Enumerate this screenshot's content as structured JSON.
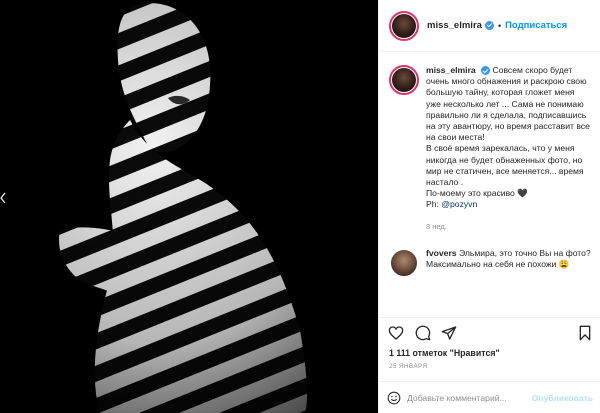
{
  "post": {
    "username": "miss_elmira",
    "follow_label": "Подписаться",
    "separator": "•",
    "caption": {
      "username": "miss_elmira",
      "text": "Совсем скоро будет очень много обнажения и раскрою свою большую тайну, которая гложет меня уже несколько лет ... Сама не понимаю правильно ли я сделала, подписавшись на эту авантюру, но время расставит все на свои места!\nВ своё время зарекалась, что у меня никогда не будет обнаженных фото, но мир не статичен, все меняется... время настало .\nПо-моему это красиво 🖤\nPh: ",
      "credit": "@pozyvn",
      "age": "3 нед."
    },
    "comments": [
      {
        "username": "fvovers",
        "text": "Эльмира, это точно Вы на фото? Максимально на себя не похожи 😩"
      }
    ],
    "likes": "1 111 отметок \"Нравится\"",
    "date": "25 ЯНВАРЯ",
    "add_comment_placeholder": "Добавьте комментарий...",
    "publish_label": "Опубликовать"
  },
  "icons": [
    "verified-badge-icon",
    "heart-icon",
    "comment-icon",
    "share-icon",
    "bookmark-icon",
    "emoji-icon",
    "arrow-left-icon"
  ],
  "colors": {
    "accent": "#0095f6",
    "verified": "#3897f0",
    "publish_disabled": "#b2dffc",
    "text": "#262626",
    "muted": "#8e8e8e",
    "border": "#efefef"
  }
}
